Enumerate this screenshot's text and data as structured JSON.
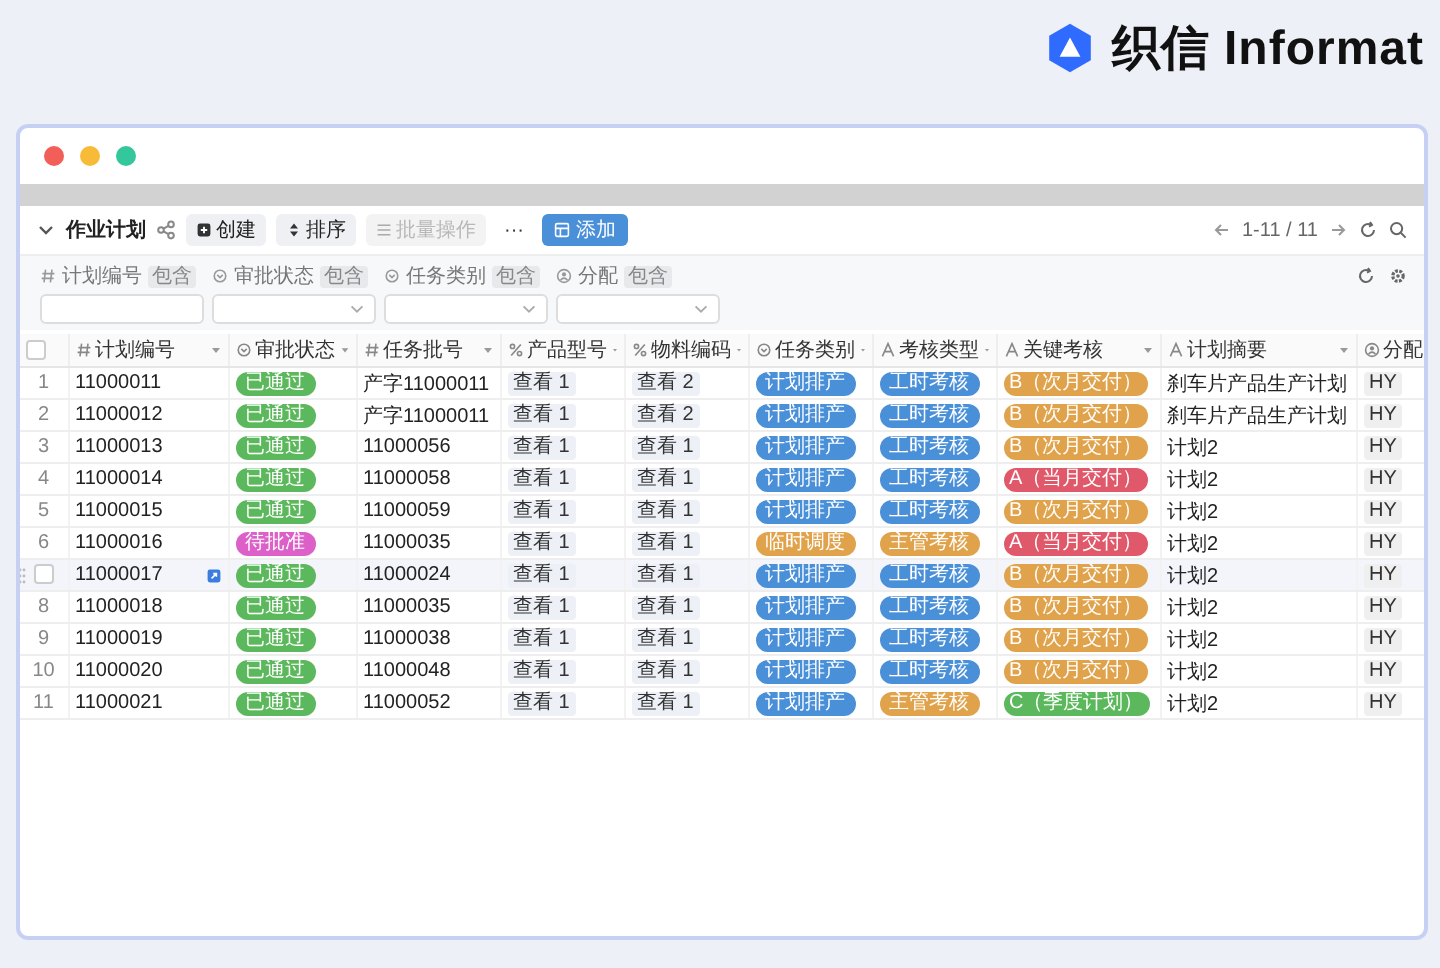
{
  "logo": {
    "text": "织信 Informat"
  },
  "toolbar": {
    "title": "作业计划",
    "buttons": [
      {
        "label": "创建",
        "kind": "create",
        "disabled": false
      },
      {
        "label": "排序",
        "kind": "sort",
        "disabled": false
      },
      {
        "label": "批量操作",
        "kind": "batch",
        "disabled": true
      }
    ],
    "more": "···",
    "add_button": "添加",
    "pagination": "1-11 / 11"
  },
  "filters": [
    {
      "label": "计划编号",
      "kind": "number",
      "operator": "包含"
    },
    {
      "label": "审批状态",
      "kind": "select",
      "operator": "包含"
    },
    {
      "label": "任务类别",
      "kind": "select",
      "operator": "包含"
    },
    {
      "label": "分配",
      "kind": "user",
      "operator": "包含"
    }
  ],
  "table": {
    "all_checked": false,
    "columns": [
      {
        "label": "计划编号",
        "kind": "number"
      },
      {
        "label": "审批状态",
        "kind": "select"
      },
      {
        "label": "任务批号",
        "kind": "number"
      },
      {
        "label": "产品型号",
        "kind": "link"
      },
      {
        "label": "物料编码",
        "kind": "link"
      },
      {
        "label": "任务类别",
        "kind": "select"
      },
      {
        "label": "考核类型",
        "kind": "text"
      },
      {
        "label": "关键考核",
        "kind": "text"
      },
      {
        "label": "计划摘要",
        "kind": "text"
      },
      {
        "label": "分配",
        "kind": "user"
      }
    ],
    "rows": [
      {
        "index": "1",
        "hovered": false,
        "plan_no": "11000011",
        "status": {
          "text": "已通过",
          "color": "#5cb85c"
        },
        "batch": "产字11000011",
        "product": "查看 1",
        "material": "查看 2",
        "category": {
          "text": "计划排产",
          "color": "#4a90d9"
        },
        "assess_type": {
          "text": "工时考核",
          "color": "#4a90d9"
        },
        "key_assess": {
          "text": "B（次月交付）",
          "color": "#e0a24a"
        },
        "summary": "刹车片产品生产计划",
        "assignee": "HY"
      },
      {
        "index": "2",
        "hovered": false,
        "plan_no": "11000012",
        "status": {
          "text": "已通过",
          "color": "#5cb85c"
        },
        "batch": "产字11000011",
        "product": "查看 1",
        "material": "查看 2",
        "category": {
          "text": "计划排产",
          "color": "#4a90d9"
        },
        "assess_type": {
          "text": "工时考核",
          "color": "#4a90d9"
        },
        "key_assess": {
          "text": "B（次月交付）",
          "color": "#e0a24a"
        },
        "summary": "刹车片产品生产计划",
        "assignee": "HY"
      },
      {
        "index": "3",
        "hovered": false,
        "plan_no": "11000013",
        "status": {
          "text": "已通过",
          "color": "#5cb85c"
        },
        "batch": "11000056",
        "product": "查看 1",
        "material": "查看 1",
        "category": {
          "text": "计划排产",
          "color": "#4a90d9"
        },
        "assess_type": {
          "text": "工时考核",
          "color": "#4a90d9"
        },
        "key_assess": {
          "text": "B（次月交付）",
          "color": "#e0a24a"
        },
        "summary": "计划2",
        "assignee": "HY"
      },
      {
        "index": "4",
        "hovered": false,
        "plan_no": "11000014",
        "status": {
          "text": "已通过",
          "color": "#5cb85c"
        },
        "batch": "11000058",
        "product": "查看 1",
        "material": "查看 1",
        "category": {
          "text": "计划排产",
          "color": "#4a90d9"
        },
        "assess_type": {
          "text": "工时考核",
          "color": "#4a90d9"
        },
        "key_assess": {
          "text": "A（当月交付）",
          "color": "#e0596a"
        },
        "summary": "计划2",
        "assignee": "HY"
      },
      {
        "index": "5",
        "hovered": false,
        "plan_no": "11000015",
        "status": {
          "text": "已通过",
          "color": "#5cb85c"
        },
        "batch": "11000059",
        "product": "查看 1",
        "material": "查看 1",
        "category": {
          "text": "计划排产",
          "color": "#4a90d9"
        },
        "assess_type": {
          "text": "工时考核",
          "color": "#4a90d9"
        },
        "key_assess": {
          "text": "B（次月交付）",
          "color": "#e0a24a"
        },
        "summary": "计划2",
        "assignee": "HY"
      },
      {
        "index": "6",
        "hovered": false,
        "plan_no": "11000016",
        "status": {
          "text": "待批准",
          "color": "#dd5fc8"
        },
        "batch": "11000035",
        "product": "查看 1",
        "material": "查看 1",
        "category": {
          "text": "临时调度",
          "color": "#e0a24a"
        },
        "assess_type": {
          "text": "主管考核",
          "color": "#e0a24a"
        },
        "key_assess": {
          "text": "A（当月交付）",
          "color": "#e0596a"
        },
        "summary": "计划2",
        "assignee": "HY"
      },
      {
        "hovered": true,
        "plan_no": "11000017",
        "status": {
          "text": "已通过",
          "color": "#5cb85c"
        },
        "batch": "11000024",
        "product": "查看 1",
        "material": "查看 1",
        "category": {
          "text": "计划排产",
          "color": "#4a90d9"
        },
        "assess_type": {
          "text": "工时考核",
          "color": "#4a90d9"
        },
        "key_assess": {
          "text": "B（次月交付）",
          "color": "#e0a24a"
        },
        "summary": "计划2",
        "assignee": "HY"
      },
      {
        "index": "8",
        "hovered": false,
        "plan_no": "11000018",
        "status": {
          "text": "已通过",
          "color": "#5cb85c"
        },
        "batch": "11000035",
        "product": "查看 1",
        "material": "查看 1",
        "category": {
          "text": "计划排产",
          "color": "#4a90d9"
        },
        "assess_type": {
          "text": "工时考核",
          "color": "#4a90d9"
        },
        "key_assess": {
          "text": "B（次月交付）",
          "color": "#e0a24a"
        },
        "summary": "计划2",
        "assignee": "HY"
      },
      {
        "index": "9",
        "hovered": false,
        "plan_no": "11000019",
        "status": {
          "text": "已通过",
          "color": "#5cb85c"
        },
        "batch": "11000038",
        "product": "查看 1",
        "material": "查看 1",
        "category": {
          "text": "计划排产",
          "color": "#4a90d9"
        },
        "assess_type": {
          "text": "工时考核",
          "color": "#4a90d9"
        },
        "key_assess": {
          "text": "B（次月交付）",
          "color": "#e0a24a"
        },
        "summary": "计划2",
        "assignee": "HY"
      },
      {
        "index": "10",
        "hovered": false,
        "plan_no": "11000020",
        "status": {
          "text": "已通过",
          "color": "#5cb85c"
        },
        "batch": "11000048",
        "product": "查看 1",
        "material": "查看 1",
        "category": {
          "text": "计划排产",
          "color": "#4a90d9"
        },
        "assess_type": {
          "text": "工时考核",
          "color": "#4a90d9"
        },
        "key_assess": {
          "text": "B（次月交付）",
          "color": "#e0a24a"
        },
        "summary": "计划2",
        "assignee": "HY"
      },
      {
        "index": "11",
        "hovered": false,
        "plan_no": "11000021",
        "status": {
          "text": "已通过",
          "color": "#5cb85c"
        },
        "batch": "11000052",
        "product": "查看 1",
        "material": "查看 1",
        "category": {
          "text": "计划排产",
          "color": "#4a90d9"
        },
        "assess_type": {
          "text": "主管考核",
          "color": "#e0a24a"
        },
        "key_assess": {
          "text": "C（季度计划）",
          "color": "#5cb85c"
        },
        "summary": "计划2",
        "assignee": "HY"
      }
    ]
  }
}
